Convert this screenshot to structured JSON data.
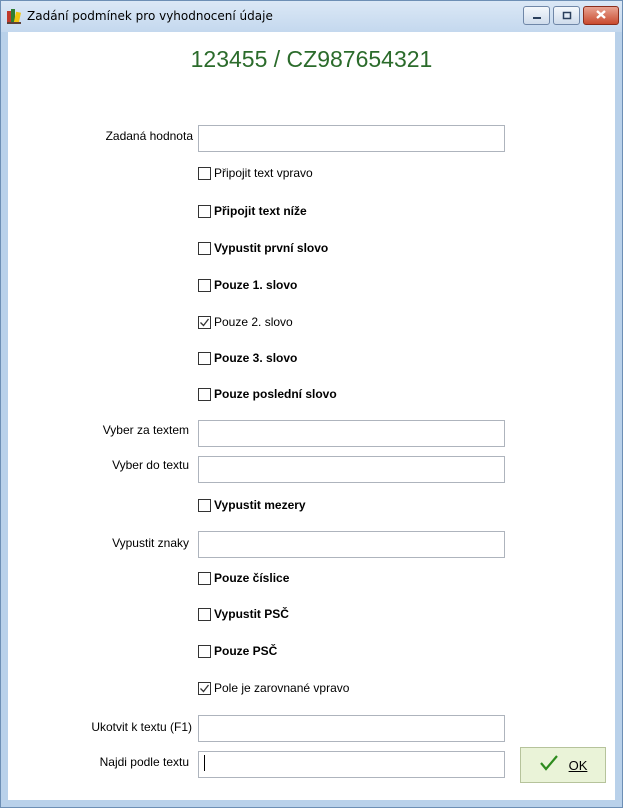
{
  "window": {
    "title": "Zadání podmínek pro vyhodnocení údaje",
    "icon": "app-books-icon"
  },
  "header": {
    "code": "123455 / CZ987654321"
  },
  "fields": {
    "zadana_hodnota": {
      "label": "Zadaná hodnota",
      "value": ""
    },
    "vyber_za_textem": {
      "label": "Vyber za textem",
      "value": ""
    },
    "vyber_do_textu": {
      "label": "Vyber do textu",
      "value": ""
    },
    "vypustit_znaky": {
      "label": "Vypustit znaky",
      "value": ""
    },
    "ukotvit_k_textu": {
      "label": "Ukotvit k textu (F1)",
      "value": ""
    },
    "najdi_podle_textu": {
      "label": "Najdi podle textu",
      "value": ""
    }
  },
  "checkboxes": [
    {
      "label": "Připojit text vpravo",
      "checked": false,
      "bold": false
    },
    {
      "label": "Připojit text níže",
      "checked": false,
      "bold": true
    },
    {
      "label": "Vypustit první slovo",
      "checked": false,
      "bold": true
    },
    {
      "label": "Pouze 1. slovo",
      "checked": false,
      "bold": true
    },
    {
      "label": "Pouze 2. slovo",
      "checked": true,
      "bold": false
    },
    {
      "label": "Pouze 3. slovo",
      "checked": false,
      "bold": true
    },
    {
      "label": "Pouze poslední slovo",
      "checked": false,
      "bold": true
    },
    {
      "label": "Vypustit mezery",
      "checked": false,
      "bold": true
    },
    {
      "label": "Pouze číslice",
      "checked": false,
      "bold": true
    },
    {
      "label": "Vypustit PSČ",
      "checked": false,
      "bold": true
    },
    {
      "label": "Pouze PSČ",
      "checked": false,
      "bold": true
    },
    {
      "label": "Pole je zarovnané vpravo",
      "checked": true,
      "bold": false
    }
  ],
  "buttons": {
    "ok": "OK"
  },
  "colors": {
    "header_code": "#2b6b2b",
    "ok_check": "#2e8b1e",
    "ok_bg": "#eaf3d8"
  }
}
